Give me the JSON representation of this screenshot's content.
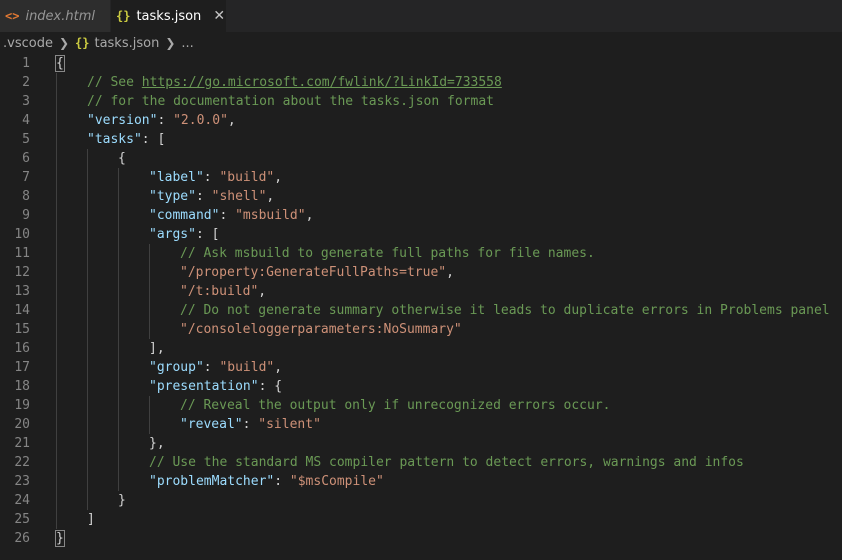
{
  "tabs": [
    {
      "label": "index.html",
      "icon": "html-icon",
      "icon_glyph": "<>",
      "active": false
    },
    {
      "label": "tasks.json",
      "icon": "json-icon",
      "icon_glyph": "{}",
      "active": true,
      "close": "✕"
    }
  ],
  "breadcrumb": {
    "folder": ".vscode",
    "file": "tasks.json",
    "file_icon_glyph": "{}",
    "tail": "...",
    "sep": "❯"
  },
  "lines": [
    {
      "n": "1",
      "indent": 0,
      "tokens": [
        {
          "t": "{",
          "c": "p",
          "hl": true
        }
      ]
    },
    {
      "n": "2",
      "indent": 1,
      "tokens": [
        {
          "t": "// See ",
          "c": "c"
        },
        {
          "t": "https://go.microsoft.com/fwlink/?LinkId=733558",
          "c": "u"
        }
      ]
    },
    {
      "n": "3",
      "indent": 1,
      "tokens": [
        {
          "t": "// for the documentation about the tasks.json format",
          "c": "c"
        }
      ]
    },
    {
      "n": "4",
      "indent": 1,
      "tokens": [
        {
          "t": "\"version\"",
          "c": "k"
        },
        {
          "t": ": ",
          "c": "p"
        },
        {
          "t": "\"2.0.0\"",
          "c": "s"
        },
        {
          "t": ",",
          "c": "p"
        }
      ]
    },
    {
      "n": "5",
      "indent": 1,
      "tokens": [
        {
          "t": "\"tasks\"",
          "c": "k"
        },
        {
          "t": ": [",
          "c": "p"
        }
      ]
    },
    {
      "n": "6",
      "indent": 2,
      "tokens": [
        {
          "t": "{",
          "c": "p"
        }
      ]
    },
    {
      "n": "7",
      "indent": 3,
      "tokens": [
        {
          "t": "\"label\"",
          "c": "k"
        },
        {
          "t": ": ",
          "c": "p"
        },
        {
          "t": "\"build\"",
          "c": "s"
        },
        {
          "t": ",",
          "c": "p"
        }
      ]
    },
    {
      "n": "8",
      "indent": 3,
      "tokens": [
        {
          "t": "\"type\"",
          "c": "k"
        },
        {
          "t": ": ",
          "c": "p"
        },
        {
          "t": "\"shell\"",
          "c": "s"
        },
        {
          "t": ",",
          "c": "p"
        }
      ]
    },
    {
      "n": "9",
      "indent": 3,
      "tokens": [
        {
          "t": "\"command\"",
          "c": "k"
        },
        {
          "t": ": ",
          "c": "p"
        },
        {
          "t": "\"msbuild\"",
          "c": "s"
        },
        {
          "t": ",",
          "c": "p"
        }
      ]
    },
    {
      "n": "10",
      "indent": 3,
      "tokens": [
        {
          "t": "\"args\"",
          "c": "k"
        },
        {
          "t": ": [",
          "c": "p"
        }
      ]
    },
    {
      "n": "11",
      "indent": 4,
      "tokens": [
        {
          "t": "// Ask msbuild to generate full paths for file names.",
          "c": "c"
        }
      ]
    },
    {
      "n": "12",
      "indent": 4,
      "tokens": [
        {
          "t": "\"/property:GenerateFullPaths=true\"",
          "c": "s"
        },
        {
          "t": ",",
          "c": "p"
        }
      ]
    },
    {
      "n": "13",
      "indent": 4,
      "tokens": [
        {
          "t": "\"/t:build\"",
          "c": "s"
        },
        {
          "t": ",",
          "c": "p"
        }
      ]
    },
    {
      "n": "14",
      "indent": 4,
      "tokens": [
        {
          "t": "// Do not generate summary otherwise it leads to duplicate errors in Problems panel",
          "c": "c"
        }
      ]
    },
    {
      "n": "15",
      "indent": 4,
      "tokens": [
        {
          "t": "\"/consoleloggerparameters:NoSummary\"",
          "c": "s"
        }
      ]
    },
    {
      "n": "16",
      "indent": 3,
      "tokens": [
        {
          "t": "],",
          "c": "p"
        }
      ]
    },
    {
      "n": "17",
      "indent": 3,
      "tokens": [
        {
          "t": "\"group\"",
          "c": "k"
        },
        {
          "t": ": ",
          "c": "p"
        },
        {
          "t": "\"build\"",
          "c": "s"
        },
        {
          "t": ",",
          "c": "p"
        }
      ]
    },
    {
      "n": "18",
      "indent": 3,
      "tokens": [
        {
          "t": "\"presentation\"",
          "c": "k"
        },
        {
          "t": ": {",
          "c": "p"
        }
      ]
    },
    {
      "n": "19",
      "indent": 4,
      "tokens": [
        {
          "t": "// Reveal the output only if unrecognized errors occur.",
          "c": "c"
        }
      ]
    },
    {
      "n": "20",
      "indent": 4,
      "tokens": [
        {
          "t": "\"reveal\"",
          "c": "k"
        },
        {
          "t": ": ",
          "c": "p"
        },
        {
          "t": "\"silent\"",
          "c": "s"
        }
      ]
    },
    {
      "n": "21",
      "indent": 3,
      "tokens": [
        {
          "t": "},",
          "c": "p"
        }
      ]
    },
    {
      "n": "22",
      "indent": 3,
      "tokens": [
        {
          "t": "// Use the standard MS compiler pattern to detect errors, warnings and infos",
          "c": "c"
        }
      ]
    },
    {
      "n": "23",
      "indent": 3,
      "tokens": [
        {
          "t": "\"problemMatcher\"",
          "c": "k"
        },
        {
          "t": ": ",
          "c": "p"
        },
        {
          "t": "\"$msCompile\"",
          "c": "s"
        }
      ]
    },
    {
      "n": "24",
      "indent": 2,
      "tokens": [
        {
          "t": "}",
          "c": "p"
        }
      ]
    },
    {
      "n": "25",
      "indent": 1,
      "tokens": [
        {
          "t": "]",
          "c": "p"
        }
      ]
    },
    {
      "n": "26",
      "indent": 0,
      "tokens": [
        {
          "t": "}",
          "c": "p",
          "hl": true
        }
      ]
    }
  ],
  "colors": {
    "background": "#1e1e1e",
    "key": "#9cdcfe",
    "string": "#ce9178",
    "comment": "#6a9955",
    "line_number": "#858585"
  }
}
